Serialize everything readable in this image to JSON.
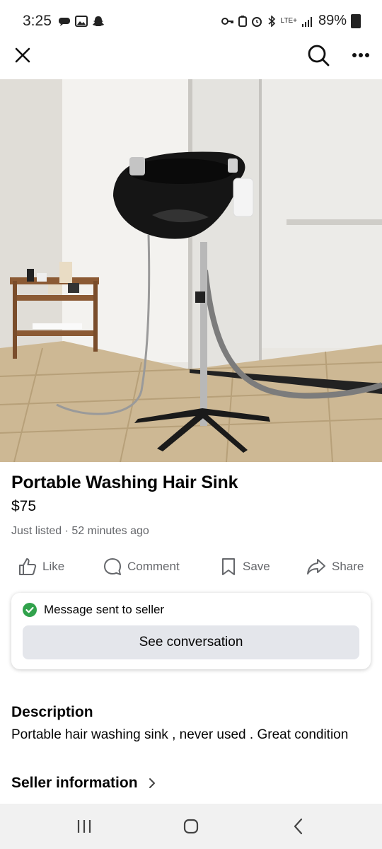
{
  "status_bar": {
    "time": "3:25",
    "network": "LTE+",
    "battery": "89%"
  },
  "listing": {
    "title": "Portable Washing Hair Sink",
    "price": "$75",
    "listed": "Just listed · 52 minutes ago"
  },
  "actions": {
    "like": "Like",
    "comment": "Comment",
    "save": "Save",
    "share": "Share"
  },
  "message": {
    "status": "Message sent to seller",
    "button": "See conversation"
  },
  "description": {
    "heading": "Description",
    "text": "Portable hair washing sink , never used . Great condition"
  },
  "seller": {
    "heading": "Seller information"
  },
  "colors": {
    "accent_green": "#31a24c",
    "secondary_text": "#65676b",
    "button_bg": "#e4e6eb"
  }
}
